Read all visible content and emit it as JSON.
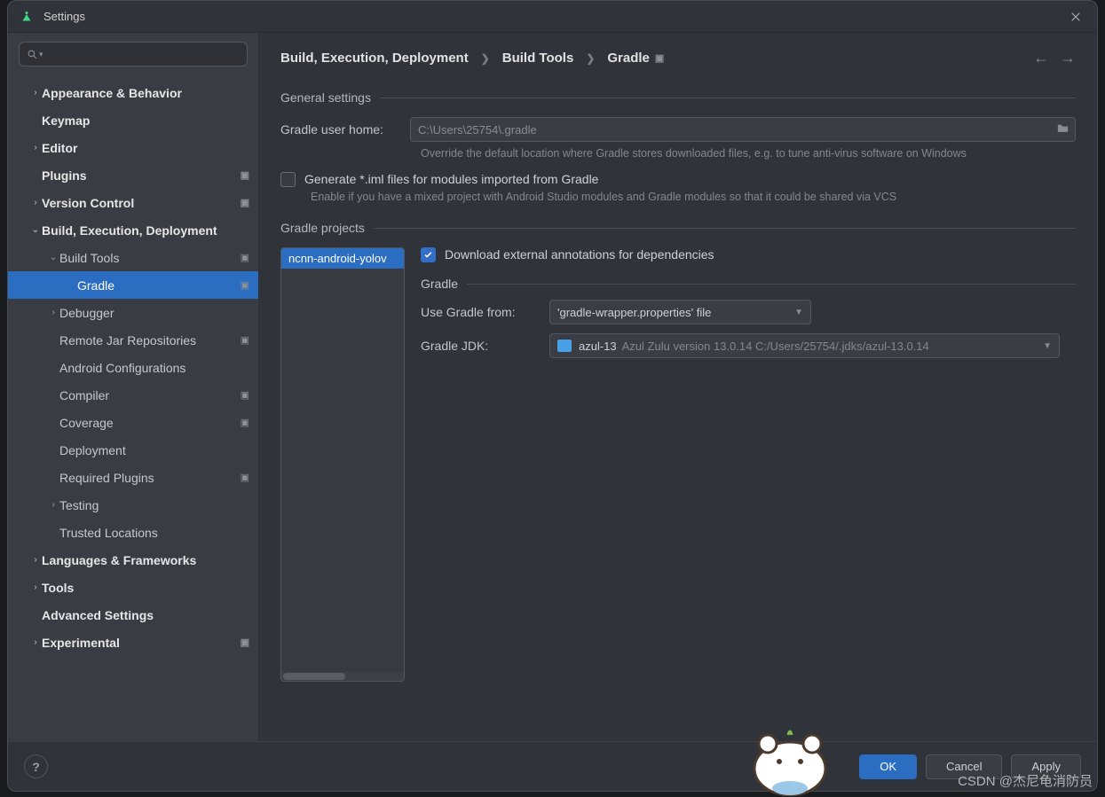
{
  "window": {
    "title": "Settings"
  },
  "search": {
    "placeholder": ""
  },
  "sidebar": {
    "items": [
      {
        "label": "Appearance & Behavior",
        "bold": true,
        "indent": 0,
        "chev": ">",
        "badge": ""
      },
      {
        "label": "Keymap",
        "bold": true,
        "indent": 0,
        "chev": "",
        "badge": ""
      },
      {
        "label": "Editor",
        "bold": true,
        "indent": 0,
        "chev": ">",
        "badge": ""
      },
      {
        "label": "Plugins",
        "bold": true,
        "indent": 0,
        "chev": "",
        "badge": "▣"
      },
      {
        "label": "Version Control",
        "bold": true,
        "indent": 0,
        "chev": ">",
        "badge": "▣"
      },
      {
        "label": "Build, Execution, Deployment",
        "bold": true,
        "indent": 0,
        "chev": "v",
        "badge": ""
      },
      {
        "label": "Build Tools",
        "bold": false,
        "indent": 1,
        "chev": "v",
        "badge": "▣"
      },
      {
        "label": "Gradle",
        "bold": false,
        "indent": 2,
        "chev": "",
        "badge": "▣",
        "selected": true
      },
      {
        "label": "Debugger",
        "bold": false,
        "indent": 1,
        "chev": ">",
        "badge": ""
      },
      {
        "label": "Remote Jar Repositories",
        "bold": false,
        "indent": 1,
        "chev": "",
        "badge": "▣"
      },
      {
        "label": "Android Configurations",
        "bold": false,
        "indent": 1,
        "chev": "",
        "badge": ""
      },
      {
        "label": "Compiler",
        "bold": false,
        "indent": 1,
        "chev": "",
        "badge": "▣"
      },
      {
        "label": "Coverage",
        "bold": false,
        "indent": 1,
        "chev": "",
        "badge": "▣"
      },
      {
        "label": "Deployment",
        "bold": false,
        "indent": 1,
        "chev": "",
        "badge": ""
      },
      {
        "label": "Required Plugins",
        "bold": false,
        "indent": 1,
        "chev": "",
        "badge": "▣"
      },
      {
        "label": "Testing",
        "bold": false,
        "indent": 1,
        "chev": ">",
        "badge": ""
      },
      {
        "label": "Trusted Locations",
        "bold": false,
        "indent": 1,
        "chev": "",
        "badge": ""
      },
      {
        "label": "Languages & Frameworks",
        "bold": true,
        "indent": 0,
        "chev": ">",
        "badge": ""
      },
      {
        "label": "Tools",
        "bold": true,
        "indent": 0,
        "chev": ">",
        "badge": ""
      },
      {
        "label": "Advanced Settings",
        "bold": true,
        "indent": 0,
        "chev": "",
        "badge": ""
      },
      {
        "label": "Experimental",
        "bold": true,
        "indent": 0,
        "chev": ">",
        "badge": "▣"
      }
    ]
  },
  "breadcrumb": {
    "a": "Build, Execution, Deployment",
    "b": "Build Tools",
    "c": "Gradle"
  },
  "general": {
    "title": "General settings",
    "home_label": "Gradle user home:",
    "home_value": "C:\\Users\\25754\\.gradle",
    "home_hint": "Override the default location where Gradle stores downloaded files, e.g. to tune anti-virus software on Windows",
    "iml_label": "Generate *.iml files for modules imported from Gradle",
    "iml_hint": "Enable if you have a mixed project with Android Studio modules and Gradle modules so that it could be shared via VCS"
  },
  "projects": {
    "title": "Gradle projects",
    "list": [
      "ncnn-android-yolov"
    ],
    "download_label": "Download external annotations for dependencies",
    "download_checked": true,
    "subhead": "Gradle",
    "use_from_label": "Use Gradle from:",
    "use_from_value": "'gradle-wrapper.properties' file",
    "jdk_label": "Gradle JDK:",
    "jdk_value": "azul-13",
    "jdk_detail": "Azul Zulu version 13.0.14 C:/Users/25754/.jdks/azul-13.0.14"
  },
  "buttons": {
    "ok": "OK",
    "cancel": "Cancel",
    "apply": "Apply"
  },
  "watermark": "CSDN @杰尼龟消防员"
}
